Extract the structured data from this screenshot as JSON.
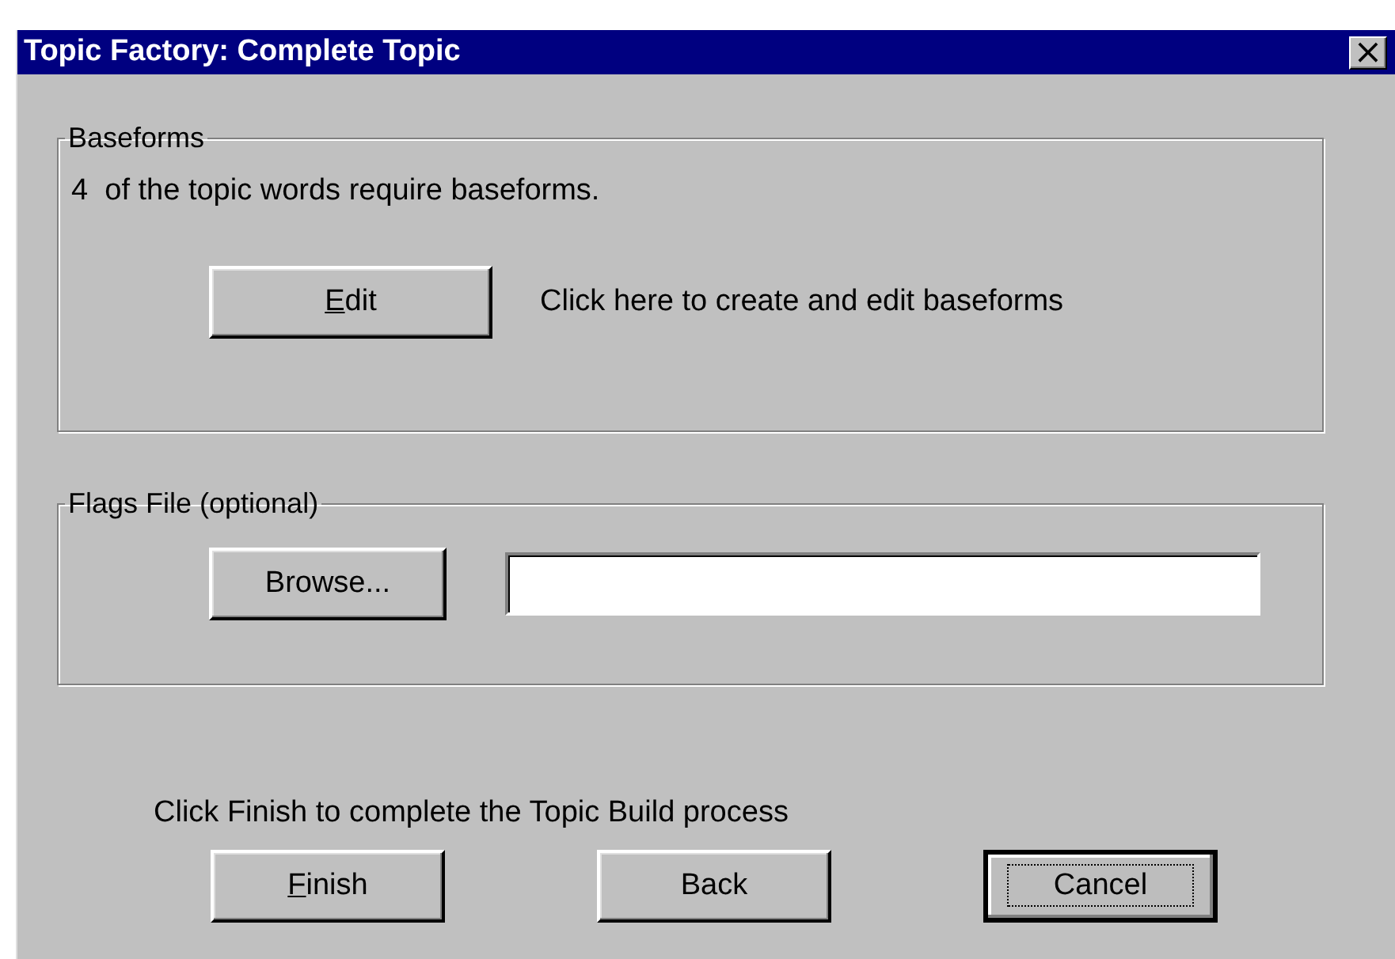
{
  "window": {
    "title": "Topic Factory: Complete Topic",
    "close_label": "×"
  },
  "baseforms": {
    "legend": "Baseforms",
    "message": "4  of the topic words require baseforms.",
    "button": {
      "label": "Edit",
      "underline_first": true,
      "focused": false
    },
    "hint": "Click here to create and edit baseforms"
  },
  "flags_file": {
    "legend": "Flags File (optional)",
    "button": {
      "label": "Browse...",
      "underline_first": false,
      "focused": false
    }
  },
  "instruction": "Click Finish to complete the Topic Build process",
  "buttons": [
    {
      "label": "Finish",
      "underline_first": true,
      "focused": false
    },
    {
      "label": "Back",
      "underline_first": false,
      "focused": false
    },
    {
      "label": "Cancel",
      "underline_first": false,
      "focused": true
    }
  ]
}
